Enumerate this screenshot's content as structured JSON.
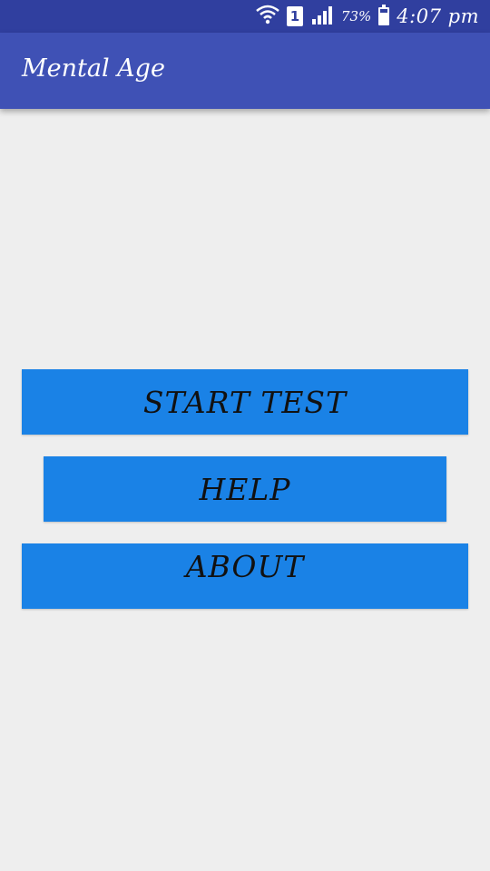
{
  "status_bar": {
    "sim_label": "1",
    "battery_percent": "73%",
    "battery_level": 0.73,
    "time": "4:07 pm",
    "icons": [
      "wifi-icon",
      "sim-icon",
      "signal-icon",
      "battery-icon"
    ]
  },
  "app_bar": {
    "title": "Mental Age",
    "color": "#3f51b5"
  },
  "buttons": {
    "start_test": "START TEST",
    "help": "HELP",
    "about": "ABOUT",
    "color": "#1a82e6"
  }
}
